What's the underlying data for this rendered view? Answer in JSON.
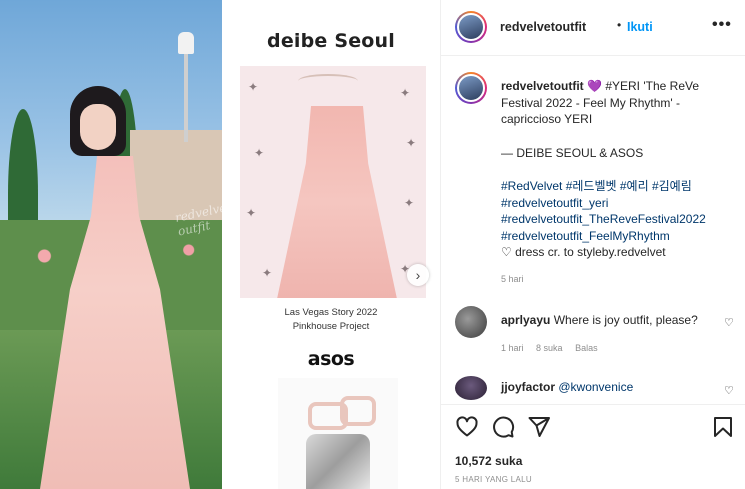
{
  "media": {
    "watermark": "redvelvet outfit",
    "collage": {
      "brand_top": "deibe Seoul",
      "dress_caption_line1": "Las Vegas Story 2022",
      "dress_caption_line2": "Pinkhouse Project",
      "brand_bottom": "asos"
    },
    "next_icon": "chevron-right-icon"
  },
  "header": {
    "username": "redvelvetoutfit",
    "separator": "•",
    "follow_label": "Ikuti",
    "more_icon": "more-horizontal-icon"
  },
  "caption": {
    "username": "redvelvetoutfit",
    "heart": "💜",
    "line1_rest": "#YERI 'The ReVe Festival 2022 - Feel My Rhythm' - capriccioso YERI",
    "line2": "— DEIBE SEOUL & ASOS",
    "hashtags": [
      "#RedVelvet #레드벨벳 #예리 #김예림",
      "#redvelvetoutfit_yeri",
      "#redvelvetoutfit_TheReveFestival2022",
      "#redvelvetoutfit_FeelMyRhythm"
    ],
    "credit": "♡ dress cr. to styleby.redvelvet",
    "time": "5 hari"
  },
  "comments": [
    {
      "username": "aprlyayu",
      "text": "Where is joy outfit, please?",
      "time": "1 hari",
      "likes": "8 suka",
      "reply": "Balas"
    },
    {
      "username": "jjoyfactor",
      "text": "@kwonvenice"
    }
  ],
  "actions": {
    "like_icon": "heart-icon",
    "comment_icon": "comment-icon",
    "share_icon": "send-icon",
    "save_icon": "bookmark-icon"
  },
  "likes_label": "10,572 suka",
  "posted_ago": "5 HARI YANG LALU",
  "colors": {
    "link_blue": "#0095f6",
    "hashtag": "#00376b",
    "muted": "#8e8e8e",
    "text": "#262626",
    "divider": "#efefef"
  }
}
